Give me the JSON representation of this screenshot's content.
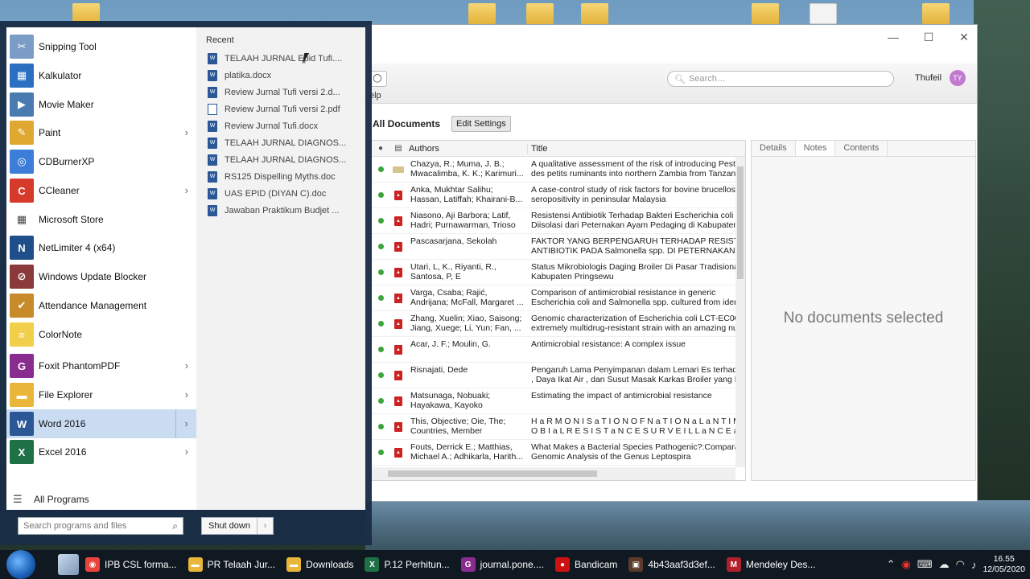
{
  "desktop": {
    "icons": [
      "folder-icon",
      "folder-icon",
      "folder-icon",
      "folder-icon",
      "folder-icon",
      "doc-icon",
      "folder-icon"
    ]
  },
  "window": {
    "controls": {
      "minimize": "—",
      "maximize": "☐",
      "close": "✕"
    },
    "toolbar": {
      "help_label": "elp",
      "search_placeholder": "Search…",
      "user_name": "Thufeil",
      "user_initials": "TY"
    },
    "header_title": "All Documents",
    "edit_settings_label": "Edit Settings",
    "columns": {
      "authors": "Authors",
      "title": "Title"
    },
    "documents": [
      {
        "authors": [
          "Chazya, R.; Muma, J. B.;",
          "Mwacalimba, K. K.; Karimuri..."
        ],
        "title": [
          "A qualitative assessment of the risk of introducing Peste",
          "des petits ruminants into northern Zambia from Tanzania"
        ],
        "file": "doc"
      },
      {
        "authors": [
          "Anka, Mukhtar Salihu;",
          "Hassan, Latiffah; Khairani-B..."
        ],
        "title": [
          "A case-control study of risk factors for bovine brucellosi",
          "seropositivity in peninsular Malaysia"
        ],
        "file": "pdf"
      },
      {
        "authors": [
          "Niasono, Aji Barbora; Latif,",
          "Hadri; Purnawarman, Trioso"
        ],
        "title": [
          "Resistensi Antibiotik Terhadap Bakteri Escherichia coli ya",
          "Diisolasi dari Peternakan Ayam Pedaging di Kabupaten S"
        ],
        "file": "pdf"
      },
      {
        "authors": [
          "Pascasarjana, Sekolah",
          ""
        ],
        "title": [
          "FAKTOR YANG BERPENGARUH TERHADAP RESISTENSI",
          "ANTIBIOTIK PADA Salmonella spp. DI PETERNAKAN BRO"
        ],
        "file": "pdf"
      },
      {
        "authors": [
          "Utari, L, K., Riyanti, R.,",
          "Santosa, P, E"
        ],
        "title": [
          "Status Mikrobiologis Daging Broiler Di Pasar Tradisional",
          "Kabupaten Pringsewu"
        ],
        "file": "pdf"
      },
      {
        "authors": [
          "Varga, Csaba; Rajić,",
          "Andrijana; McFall, Margaret ..."
        ],
        "title": [
          "Comparison of antimicrobial resistance in generic",
          "Escherichia coli and Salmonella spp. cultured from identic"
        ],
        "file": "pdf"
      },
      {
        "authors": [
          "Zhang, Xuelin; Xiao, Saisong;",
          "Jiang, Xuege; Li, Yun; Fan, ..."
        ],
        "title": [
          "Genomic characterization of Escherichia coli LCT-EC001,",
          "extremely multidrug-resistant strain with an amazing nur"
        ],
        "file": "pdf"
      },
      {
        "authors": [
          "Acar, J. F.; Moulin, G.",
          ""
        ],
        "title": [
          "Antimicrobial resistance: A complex issue",
          ""
        ],
        "file": "pdf"
      },
      {
        "authors": [
          "Risnajati, Dede",
          ""
        ],
        "title": [
          "Pengaruh Lama Penyimpanan dalam Lemari Es terhadap",
          ", Daya Ikat Air , dan Susut Masak Karkas Broiler yang Di"
        ],
        "file": "pdf"
      },
      {
        "authors": [
          "Matsunaga, Nobuaki;",
          "Hayakawa, Kayoko"
        ],
        "title": [
          "Estimating the impact of antimicrobial resistance",
          ""
        ],
        "file": "pdf"
      },
      {
        "authors": [
          "This, Objective; Oie, The;",
          "Countries, Member"
        ],
        "title": [
          "H a R M O N I S a T I O N O F N a T I O N a L a N T I M I",
          "O B I a L R E S I S T a N C E S U R V E I L L a N C E a N D"
        ],
        "file": "pdf"
      },
      {
        "authors": [
          "Fouts, Derrick E.; Matthias,",
          "Michael A.; Adhikarla, Harith..."
        ],
        "title": [
          "What Makes a Bacterial Species Pathogenic?:Comparativ",
          "Genomic Analysis of the Genus Leptospira"
        ],
        "file": "pdf"
      }
    ],
    "detail_tabs": [
      "Details",
      "Notes",
      "Contents"
    ],
    "no_docs_text": "No documents selected"
  },
  "start_menu": {
    "apps": [
      {
        "label": "Snipping Tool",
        "icon": "scissors-icon",
        "color": "#7a9cc7",
        "glyph": "✂",
        "arrow": false
      },
      {
        "label": "Kalkulator",
        "icon": "calculator-icon",
        "color": "#2b6fc0",
        "glyph": "▦",
        "arrow": false
      },
      {
        "label": "Movie Maker",
        "icon": "film-icon",
        "color": "#4a7bb0",
        "glyph": "▶",
        "arrow": false
      },
      {
        "label": "Paint",
        "icon": "palette-icon",
        "color": "#e0a830",
        "glyph": "✎",
        "arrow": true
      },
      {
        "label": "CDBurnerXP",
        "icon": "disc-icon",
        "color": "#3b7dd8",
        "glyph": "◎",
        "arrow": false
      },
      {
        "label": "CCleaner",
        "icon": "ccleaner-icon",
        "color": "#d63a2a",
        "glyph": "C",
        "arrow": true
      },
      {
        "label": "Microsoft Store",
        "icon": "store-icon",
        "color": "#ffffff",
        "glyph": "▦",
        "arrow": false
      },
      {
        "label": "NetLimiter 4 (x64)",
        "icon": "netlimiter-icon",
        "color": "#1f4f8a",
        "glyph": "N",
        "arrow": false
      },
      {
        "label": "Windows Update Blocker",
        "icon": "shield-icon",
        "color": "#8a3a3a",
        "glyph": "⊘",
        "arrow": false
      },
      {
        "label": "Attendance Management",
        "icon": "attendance-icon",
        "color": "#c98a2a",
        "glyph": "✔",
        "arrow": false
      },
      {
        "label": "ColorNote",
        "icon": "note-icon",
        "color": "#f2cf4a",
        "glyph": "≡",
        "arrow": false
      },
      {
        "label": "Foxit PhantomPDF",
        "icon": "foxit-icon",
        "color": "#8a2b8f",
        "glyph": "G",
        "arrow": true
      },
      {
        "label": "File Explorer",
        "icon": "folder-icon",
        "color": "#e9b63a",
        "glyph": "▬",
        "arrow": true
      },
      {
        "label": "Word 2016",
        "icon": "word-icon",
        "color": "#2b5797",
        "glyph": "W",
        "arrow": true,
        "selected": true
      },
      {
        "label": "Excel 2016",
        "icon": "excel-icon",
        "color": "#1e7145",
        "glyph": "X",
        "arrow": true
      }
    ],
    "all_programs": "All Programs",
    "recent_label": "Recent",
    "recent": [
      {
        "label": "TELAAH JURNAL Epid Tufi....",
        "type": "word"
      },
      {
        "label": "platika.docx",
        "type": "word"
      },
      {
        "label": "Review Jurnal Tufi versi 2.d...",
        "type": "word"
      },
      {
        "label": "Review Jurnal Tufi versi 2.pdf",
        "type": "pdf"
      },
      {
        "label": "Review Jurnal Tufi.docx",
        "type": "word"
      },
      {
        "label": "TELAAH JURNAL DIAGNOS...",
        "type": "word"
      },
      {
        "label": "TELAAH JURNAL DIAGNOS...",
        "type": "word"
      },
      {
        "label": "RS125 Dispelling Myths.doc",
        "type": "word"
      },
      {
        "label": "UAS EPID (DIYAN C).doc",
        "type": "word"
      },
      {
        "label": "Jawaban Praktikum Budjet ...",
        "type": "word"
      }
    ],
    "search_placeholder": "Search programs and files",
    "shutdown_label": "Shut down"
  },
  "taskbar": {
    "items": [
      {
        "label": "IPB CSL forma...",
        "icon": "chrome-icon",
        "color": "#e8453c",
        "glyph": "◉"
      },
      {
        "label": "PR Telaah Jur...",
        "icon": "folder-icon",
        "color": "#e9b63a",
        "glyph": "▬"
      },
      {
        "label": "Downloads",
        "icon": "folder-icon",
        "color": "#e9b63a",
        "glyph": "▬"
      },
      {
        "label": "P.12 Perhitun...",
        "icon": "excel-icon",
        "color": "#1e7145",
        "glyph": "X"
      },
      {
        "label": "journal.pone....",
        "icon": "foxit-icon",
        "color": "#8a2b8f",
        "glyph": "G"
      },
      {
        "label": "Bandicam",
        "icon": "record-icon",
        "color": "#cc1111",
        "glyph": "●"
      },
      {
        "label": "4b43aaf3d3ef...",
        "icon": "image-icon",
        "color": "#5a3a2a",
        "glyph": "▣"
      },
      {
        "label": "Mendeley Des...",
        "icon": "mendeley-icon",
        "color": "#b0212b",
        "glyph": "M"
      }
    ],
    "tray_icons": [
      "chevron-up-icon",
      "record-tray-icon",
      "keyboard-icon",
      "cloud-icon",
      "wifi-icon",
      "volume-icon"
    ],
    "time": "16.55",
    "date": "12/05/2020"
  }
}
